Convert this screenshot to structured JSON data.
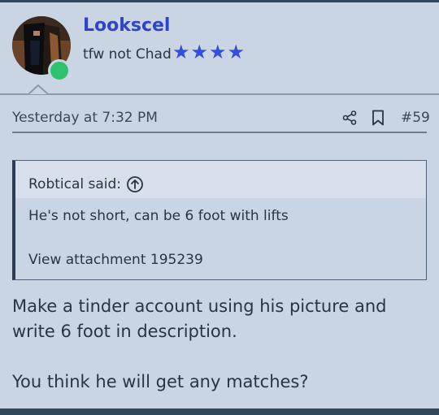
{
  "user": {
    "name": "Lookscel",
    "title": "tfw not Chad",
    "star_glyphs": [
      "★",
      "★",
      "★",
      "★"
    ],
    "online_color": "#2fc26e"
  },
  "post_meta": {
    "date": "Yesterday at 7:32 PM",
    "share_icon": "share-icon",
    "bookmark_icon": "bookmark-icon",
    "number": "#59"
  },
  "quote": {
    "author_said": "Robtical said:",
    "jump_icon": "arrow-up-circle-icon",
    "lines": [
      "He's not short, can be 6 foot with lifts",
      "View attachment 195239"
    ]
  },
  "message": {
    "paragraphs": [
      "Make a tinder account using his picture and write 6 foot in description.",
      "You think he will get any matches?"
    ]
  },
  "colors": {
    "background": "#c9d5e2",
    "username": "#2f45c9",
    "stars": "#3550d8",
    "border": "#34465a"
  }
}
